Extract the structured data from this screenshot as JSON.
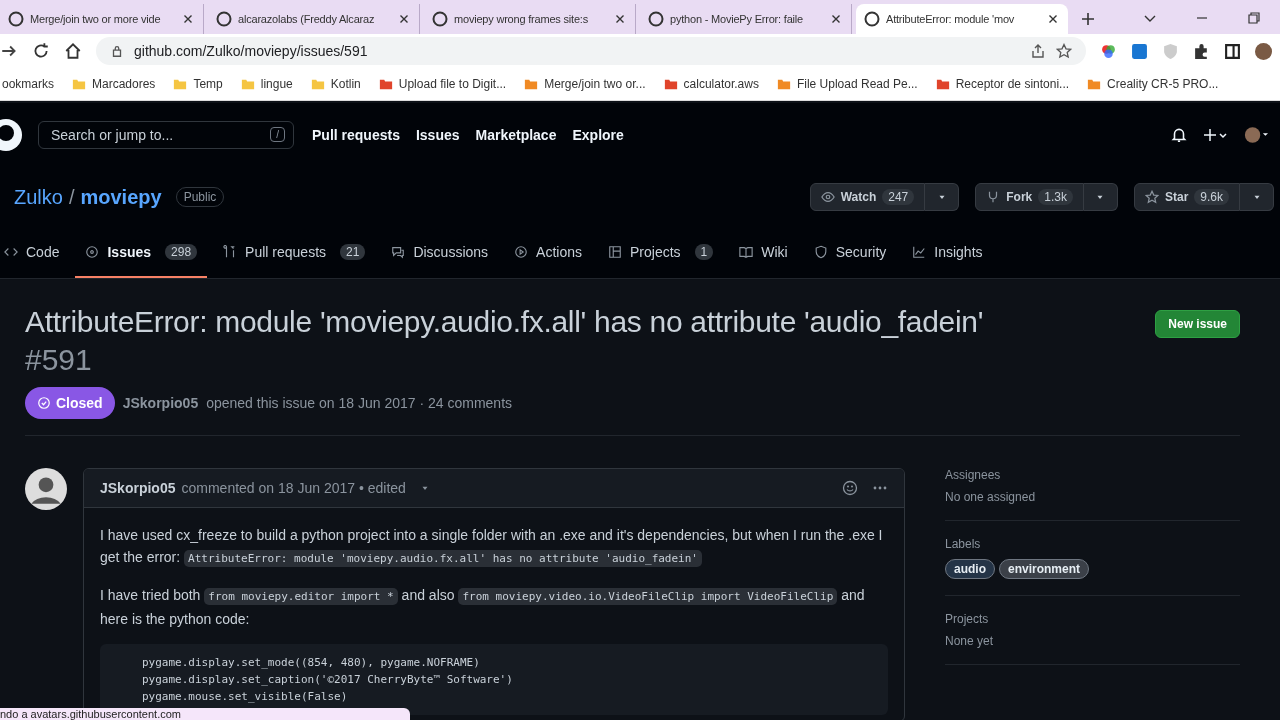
{
  "browser": {
    "tabs": [
      {
        "title": "Merge/join two or more vide",
        "selected": false
      },
      {
        "title": "alcarazolabs (Freddy Alcaraz",
        "selected": false
      },
      {
        "title": "moviepy wrong frames site:s",
        "selected": false
      },
      {
        "title": "python - MoviePy Error: faile",
        "selected": false
      },
      {
        "title": "AttributeError: module 'mov",
        "selected": true
      }
    ],
    "url": "github.com/Zulko/moviepy/issues/591",
    "bookmarks": [
      "ookmarks",
      "Marcadores",
      "Temp",
      "lingue",
      "Kotlin",
      "Upload file to Digit...",
      "Merge/join two or...",
      "calculator.aws",
      "File Upload Read Pe...",
      "Receptor de sintoni...",
      "Creality CR-5 PRO..."
    ],
    "status_text": "ndo a avatars.githubusercontent.com"
  },
  "header": {
    "search_placeholder": "Search or jump to...",
    "search_key": "/",
    "nav": [
      "Pull requests",
      "Issues",
      "Marketplace",
      "Explore"
    ]
  },
  "repo": {
    "owner": "Zulko",
    "separator": "/",
    "name": "moviepy",
    "visibility": "Public",
    "actions": [
      {
        "label": "Watch",
        "count": "247"
      },
      {
        "label": "Fork",
        "count": "1.3k"
      },
      {
        "label": "Star",
        "count": "9.6k"
      }
    ],
    "tabs": [
      {
        "label": "Code",
        "selected": false
      },
      {
        "label": "Issues",
        "count": "298",
        "selected": true
      },
      {
        "label": "Pull requests",
        "count": "21",
        "selected": false
      },
      {
        "label": "Discussions",
        "selected": false
      },
      {
        "label": "Actions",
        "selected": false
      },
      {
        "label": "Projects",
        "count": "1",
        "selected": false
      },
      {
        "label": "Wiki",
        "selected": false
      },
      {
        "label": "Security",
        "selected": false
      },
      {
        "label": "Insights",
        "selected": false
      }
    ]
  },
  "issue": {
    "title": "AttributeError: module 'moviepy.audio.fx.all' has no attribute 'audio_fadein'",
    "number": "#591",
    "new_issue": "New issue",
    "state": "Closed",
    "author": "JSkorpio05",
    "meta": "opened this issue on 18 Jun 2017 · 24 comments"
  },
  "comment": {
    "author": "JSkorpio05",
    "meta": "commented on 18 Jun 2017 • edited",
    "paragraphs": [
      [
        {
          "text": "I have used cx_freeze to build a python project into a single folder with an .exe and it's dependencies, but when I run the .exe I get the error: ",
          "code": false
        },
        {
          "text": "AttributeError: module 'moviepy.audio.fx.all' has no attribute 'audio_fadein'",
          "code": true
        }
      ],
      [
        {
          "text": "I have tried both ",
          "code": false
        },
        {
          "text": "from moviepy.editor import *",
          "code": true
        },
        {
          "text": " and also ",
          "code": false
        },
        {
          "text": "from moviepy.video.io.VideoFileClip import VideoFileClip",
          "code": true
        },
        {
          "text": " and here is the python code:",
          "code": false
        }
      ]
    ],
    "code_lines": [
      "pygame.display.set_mode((854, 480), pygame.NOFRAME)",
      "pygame.display.set_caption('©2017 CherryByte™ Software')",
      "pygame.mouse.set_visible(False)"
    ]
  },
  "sidebar": [
    {
      "heading": "Assignees",
      "value": "No one assigned"
    },
    {
      "heading": "Labels",
      "labels": [
        {
          "name": "audio",
          "color": "#243447"
        },
        {
          "name": "environment",
          "color": "#3b4048"
        }
      ]
    },
    {
      "heading": "Projects",
      "value": "None yet"
    }
  ]
}
